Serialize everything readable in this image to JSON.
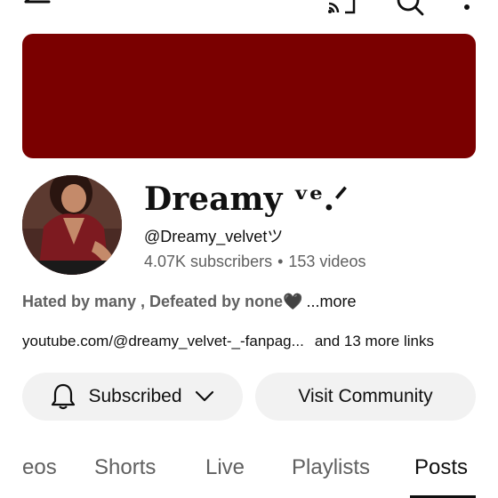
{
  "toolbar": {
    "back_icon": "arrow-left-icon",
    "cast_icon": "cast-icon",
    "search_icon": "search-icon",
    "menu_icon": "more-vertical-icon"
  },
  "colors": {
    "banner": "#7a0000",
    "text_primary": "#0f0f0f",
    "text_secondary": "#606060",
    "button_bg": "#f2f2f2"
  },
  "channel": {
    "name": "Dreamy ᵛᵉ.ᐟ",
    "handle": "@Dreamy_velvetツ",
    "subscribers": "4.07K subscribers",
    "separator": "•",
    "videos": "153 videos",
    "description": "Hated by many , Defeated by none🖤",
    "more": "...more",
    "link": "youtube.com/@dreamy_velvet-_-fanpag...",
    "more_links": "and 13 more links"
  },
  "buttons": {
    "subscribed": "Subscribed",
    "visit_community": "Visit Community"
  },
  "tabs": [
    {
      "label": "eos",
      "active": false
    },
    {
      "label": "Shorts",
      "active": false
    },
    {
      "label": "Live",
      "active": false
    },
    {
      "label": "Playlists",
      "active": false
    },
    {
      "label": "Posts",
      "active": true
    }
  ]
}
